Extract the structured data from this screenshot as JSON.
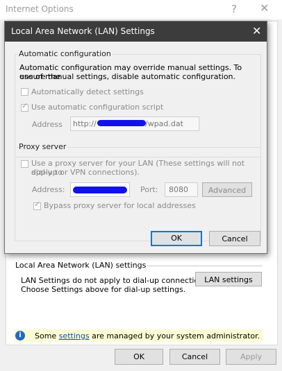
{
  "internet_options": {
    "title": "Internet Options",
    "help_glyph": "?",
    "close_glyph": "✕",
    "lan_group_title": "Local Area Network (LAN) settings",
    "lan_desc_line1": "LAN Settings do not apply to dial-up connections.",
    "lan_desc_line2": "Choose Settings above for dial-up settings.",
    "lan_settings_button": "LAN settings",
    "admin_notice_prefix": "Some",
    "admin_notice_link": "settings",
    "admin_notice_suffix": "are managed by your system administrator.",
    "info_glyph": "i",
    "ok_button": "OK",
    "cancel_button": "Cancel",
    "apply_button": "Apply"
  },
  "lan_dialog": {
    "title": "Local Area Network (LAN) Settings",
    "close_glyph": "✕",
    "auto_config": {
      "title": "Automatic configuration",
      "desc_line1": "Automatic configuration may override manual settings.  To ensure the",
      "desc_line2": "use of manual settings, disable automatic configuration.",
      "auto_detect_label": "Automatically detect settings",
      "auto_detect_checked": false,
      "use_script_label": "Use automatic configuration script",
      "use_script_checked": true,
      "address_label": "Address",
      "address_prefix": "http://",
      "address_suffix": "/wpad.dat"
    },
    "proxy": {
      "title": "Proxy server",
      "use_proxy_line1": "Use a proxy server for your LAN (These settings will not apply to",
      "use_proxy_line2": "dial-up or VPN connections).",
      "use_proxy_checked": false,
      "address_label": "Address:",
      "port_label": "Port:",
      "port_value": "8080",
      "advanced_button": "Advanced",
      "bypass_label": "Bypass proxy server for local addresses",
      "bypass_checked": true
    },
    "ok_button": "OK",
    "cancel_button": "Cancel"
  },
  "check_glyph": "✓",
  "colors": {
    "dialog_titlebar": "#3c3c3c",
    "focus_border": "#0078d7",
    "redaction": "#1111ee",
    "notice_bg": "#fdfbd4",
    "link": "#0b4fa8"
  }
}
